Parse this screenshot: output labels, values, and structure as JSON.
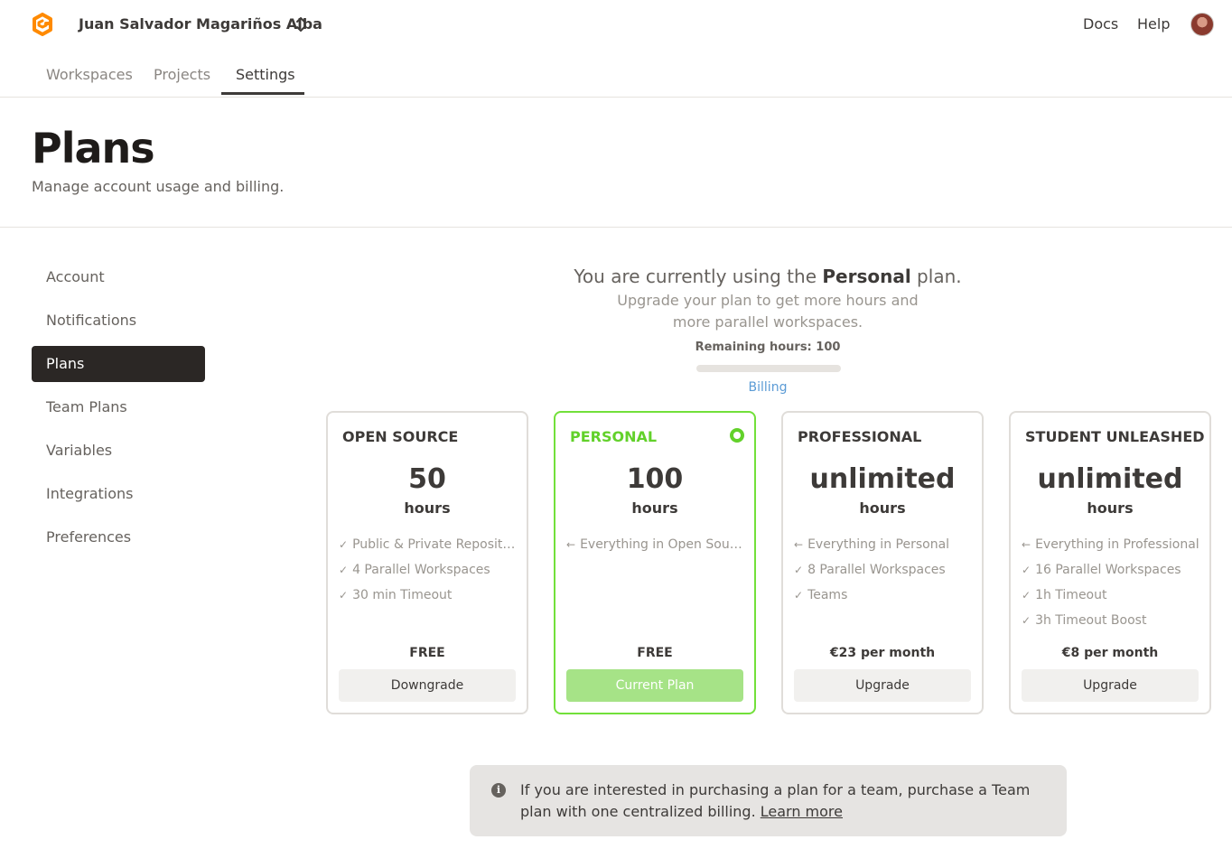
{
  "header": {
    "account_name": "Juan Salvador Magariños Alba",
    "links": [
      "Docs",
      "Help"
    ],
    "icons": {
      "logo": "gitpod-logo-icon",
      "switcher": "chevron-up-down-icon",
      "avatar": "user-avatar"
    },
    "brand_color": "#ff8a00"
  },
  "tabs": [
    "Workspaces",
    "Projects",
    "Settings"
  ],
  "active_tab": "Settings",
  "page": {
    "title": "Plans",
    "subtitle": "Manage account usage and billing."
  },
  "sidebar": {
    "items": [
      "Account",
      "Notifications",
      "Plans",
      "Team Plans",
      "Variables",
      "Integrations",
      "Preferences"
    ],
    "active": "Plans"
  },
  "intro": {
    "prefix": "You are currently using the ",
    "plan": "Personal",
    "suffix": " plan.",
    "upgrade": "Upgrade your plan to get more hours and more parallel workspaces.",
    "remaining": "Remaining hours: 100",
    "remaining_fraction": 0,
    "billing_link": "Billing"
  },
  "plans": [
    {
      "name": "OPEN SOURCE",
      "amount": "50",
      "unit": "hours",
      "features": [
        {
          "mark": "✓",
          "text": "Public & Private Repositories"
        },
        {
          "mark": "✓",
          "text": "4 Parallel Workspaces"
        },
        {
          "mark": "✓",
          "text": "30 min Timeout"
        }
      ],
      "price": "FREE",
      "button": "Downgrade",
      "current": false
    },
    {
      "name": "PERSONAL",
      "amount": "100",
      "unit": "hours",
      "features": [
        {
          "mark": "←",
          "text": "Everything in Open Source"
        }
      ],
      "price": "FREE",
      "button": "Current Plan",
      "current": true
    },
    {
      "name": "PROFESSIONAL",
      "amount": "unlimited",
      "unit": "hours",
      "features": [
        {
          "mark": "←",
          "text": "Everything in Personal"
        },
        {
          "mark": "✓",
          "text": "8 Parallel Workspaces"
        },
        {
          "mark": "✓",
          "text": "Teams"
        }
      ],
      "price": "€23 per month",
      "button": "Upgrade",
      "current": false
    },
    {
      "name": "STUDENT UNLEASHED",
      "amount": "unlimited",
      "unit": "hours",
      "features": [
        {
          "mark": "←",
          "text": "Everything in Professional"
        },
        {
          "mark": "✓",
          "text": "16 Parallel Workspaces"
        },
        {
          "mark": "✓",
          "text": "1h Timeout"
        },
        {
          "mark": "✓",
          "text": "3h Timeout Boost"
        }
      ],
      "price": "€8 per month",
      "button": "Upgrade",
      "current": false
    }
  ],
  "notice": {
    "icon": "info-icon",
    "text": "If you are interested in purchasing a plan for a team, purchase a Team plan with one centralized billing.",
    "link": "Learn more"
  }
}
